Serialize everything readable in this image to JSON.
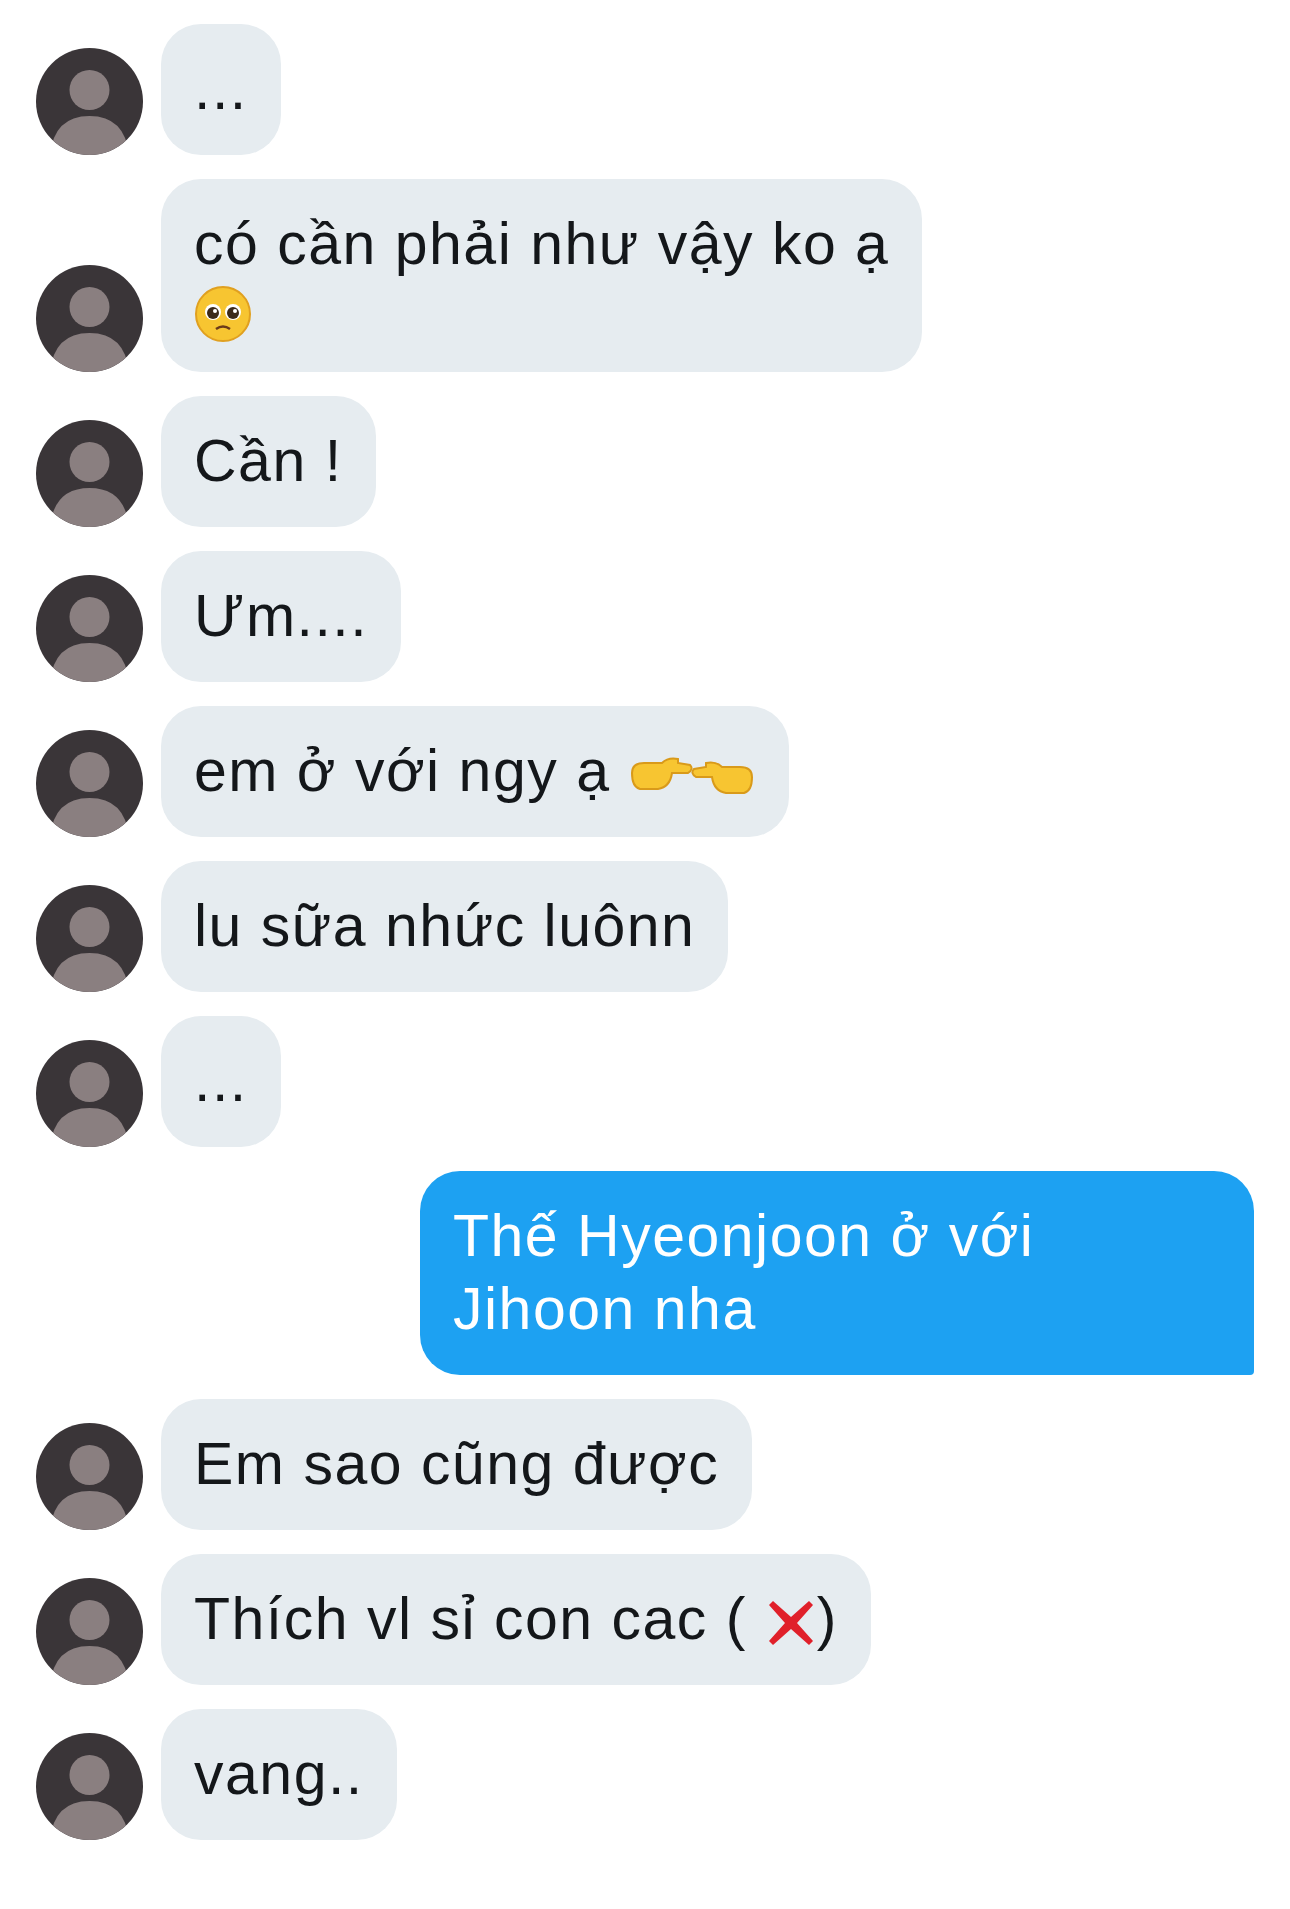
{
  "messages": [
    {
      "outgoing": false,
      "parts": [
        {
          "kind": "text",
          "text": "..."
        }
      ]
    },
    {
      "outgoing": false,
      "parts": [
        {
          "kind": "text",
          "text": "có cần phải như vậy ko ạ"
        },
        {
          "kind": "pleading"
        }
      ]
    },
    {
      "outgoing": false,
      "parts": [
        {
          "kind": "text",
          "text": "Cần !"
        }
      ]
    },
    {
      "outgoing": false,
      "parts": [
        {
          "kind": "text",
          "text": "Ưm...."
        }
      ]
    },
    {
      "outgoing": false,
      "parts": [
        {
          "kind": "text",
          "text": "em ở với ngy ạ"
        },
        {
          "kind": "pointing"
        }
      ]
    },
    {
      "outgoing": false,
      "parts": [
        {
          "kind": "text",
          "text": "lu sữa nhức luônn"
        }
      ]
    },
    {
      "outgoing": false,
      "parts": [
        {
          "kind": "text",
          "text": "..."
        }
      ]
    },
    {
      "outgoing": true,
      "parts": [
        {
          "kind": "text",
          "text": "Thế Hyeonjoon ở với Jihoon nha"
        }
      ]
    },
    {
      "outgoing": false,
      "parts": [
        {
          "kind": "text",
          "text": "Em sao cũng được"
        }
      ]
    },
    {
      "outgoing": false,
      "parts": [
        {
          "kind": "text",
          "text": "Thích vl sỉ con cac ("
        },
        {
          "kind": "cross"
        },
        {
          "kind": "text",
          "text": ")"
        }
      ]
    },
    {
      "outgoing": false,
      "parts": [
        {
          "kind": "text",
          "text": "vang.."
        }
      ]
    }
  ]
}
